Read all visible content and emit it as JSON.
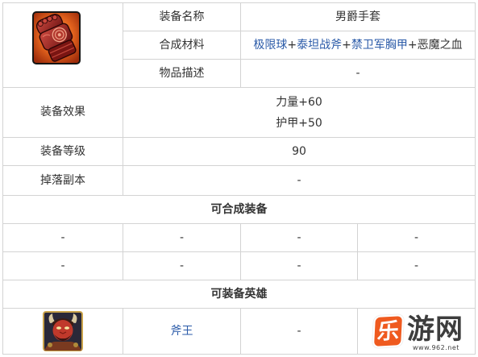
{
  "colors": {
    "border": "#d3d3d3",
    "text": "#333333",
    "link": "#2a5aa8",
    "logo_orange": "#ef5a1f",
    "logo_text": "#3d3d3d"
  },
  "item": {
    "icon": "baron-gauntlet-icon",
    "name": {
      "label": "装备名称",
      "value": "男爵手套"
    },
    "materials": {
      "label": "合成材料",
      "parts": [
        {
          "text": "极限球",
          "link": true
        },
        {
          "text": "+",
          "link": false
        },
        {
          "text": "泰坦战斧",
          "link": true
        },
        {
          "text": "+",
          "link": false
        },
        {
          "text": "禁卫军胸甲",
          "link": true
        },
        {
          "text": "+",
          "link": false
        },
        {
          "text": "恶魔之血",
          "link": false
        }
      ]
    },
    "description": {
      "label": "物品描述",
      "value": "-"
    }
  },
  "stats": {
    "effects": {
      "label": "装备效果",
      "lines": [
        "力量+60",
        "护甲+50"
      ]
    },
    "level": {
      "label": "装备等级",
      "value": "90"
    },
    "drop": {
      "label": "掉落副本",
      "value": "-"
    }
  },
  "craftable": {
    "title": "可合成装备",
    "rows": [
      [
        "-",
        "-",
        "-",
        "-"
      ],
      [
        "-",
        "-",
        "-",
        "-"
      ]
    ]
  },
  "heroes": {
    "title": "可装备英雄",
    "list": [
      {
        "portrait": "axe-hero-portrait",
        "name": "斧王",
        "cells": [
          "-"
        ]
      }
    ]
  },
  "watermark": {
    "logo_char": "乐",
    "name": "游网",
    "url": "www.962.net"
  }
}
